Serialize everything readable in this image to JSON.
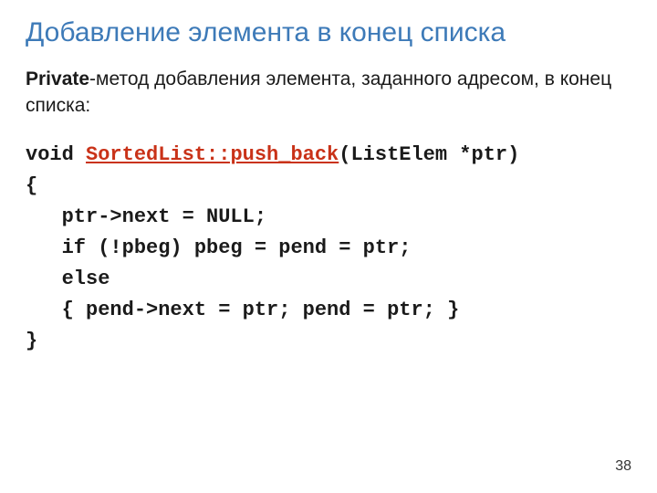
{
  "slide": {
    "title": "Добавление элемента в конец списка",
    "desc_bold": "Private",
    "desc_rest": "-метод добавления элемента, заданного адресом, в конец списка:",
    "page_number": "38"
  },
  "code": {
    "l1_a": "void ",
    "l1_b": "SortedList::push_back",
    "l1_c": "(ListElem *ptr)",
    "l2": "{",
    "l3": "   ptr->next = NULL;",
    "l4": "   if (!pbeg) pbeg = pend = ptr;",
    "l5": "   else",
    "l6": "   { pend->next = ptr; pend = ptr; }",
    "l7": "}"
  }
}
